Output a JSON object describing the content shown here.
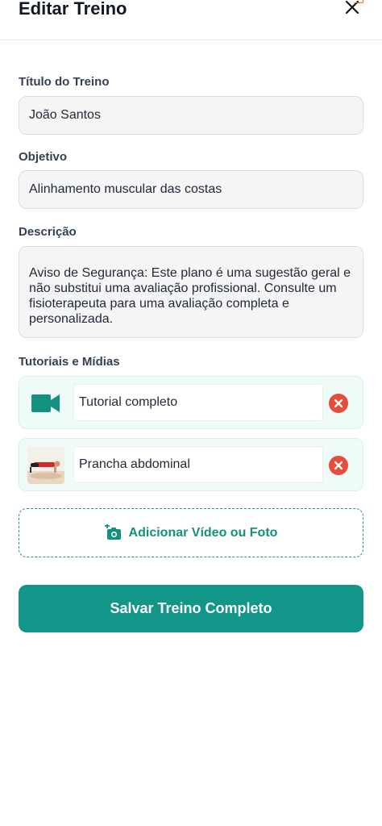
{
  "header": {
    "title": "Editar Treino",
    "close_icon": "close-icon"
  },
  "form": {
    "title_label": "Título do Treino",
    "title_value": "João Santos",
    "objective_label": "Objetivo",
    "objective_value": "Alinhamento muscular das costas",
    "description_label": "Descrição",
    "description_value": "Aviso de Segurança: Este plano é uma sugestão geral e não substitui uma avaliação profissional. Consulte um fisioterapeuta para uma avaliação completa e personalizada."
  },
  "media": {
    "section_label": "Tutoriais e Mídias",
    "items": [
      {
        "type": "video",
        "icon": "video-camera-icon",
        "title": "Tutorial completo"
      },
      {
        "type": "photo",
        "icon": "plank-exercise-thumbnail",
        "title": "Prancha abdominal"
      }
    ],
    "remove_icon": "remove-circle-icon",
    "add_label": "Adicionar Vídeo ou Foto",
    "add_icon": "add-photo-icon"
  },
  "actions": {
    "save_label": "Salvar Treino Completo"
  },
  "colors": {
    "accent": "#12968a",
    "accent_light_bg": "#eefbf8",
    "remove": "#e74c3c",
    "field_bg": "#f5f5f5",
    "label": "#334155"
  }
}
